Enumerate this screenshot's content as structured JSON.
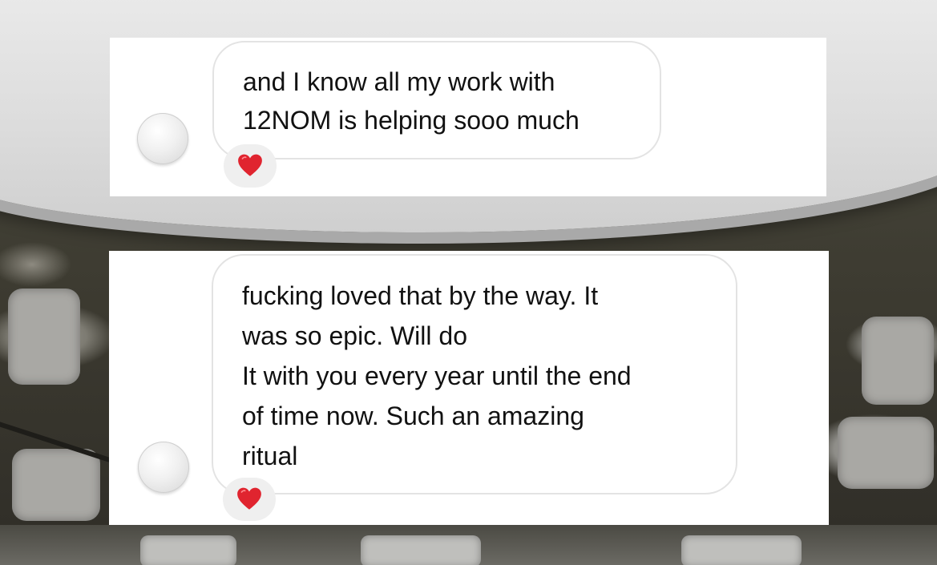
{
  "conversation": {
    "messages": [
      {
        "lines": [
          "and I know all my work with",
          "12NOM is helping sooo much"
        ],
        "reaction": "❤️"
      },
      {
        "lines": [
          "fucking loved that by the way. It",
          "was so epic. Will do",
          "It with you every year until the end",
          "of time now. Such an amazing",
          "ritual"
        ],
        "reaction": "❤️"
      }
    ]
  },
  "colors": {
    "bubble_border": "#e3e3e3",
    "reaction_bg": "#efefef",
    "heart": "#e0242f",
    "text": "#111111"
  },
  "icons": {
    "avatar": "avatar-circle-icon",
    "reaction": "heart-icon"
  }
}
